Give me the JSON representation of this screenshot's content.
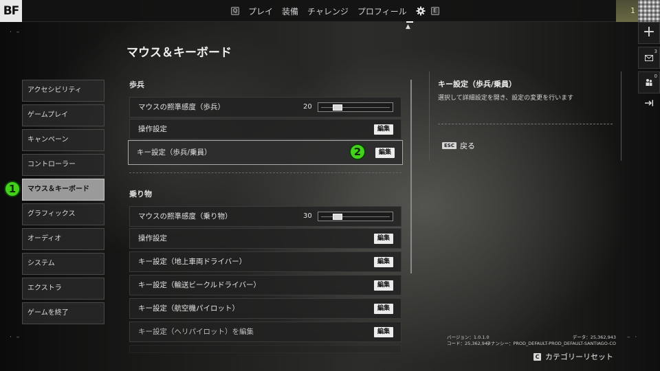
{
  "topbar": {
    "logo": "BF",
    "left_key": "Q",
    "nav": [
      "プレイ",
      "装備",
      "チャレンジ",
      "プロフィール"
    ],
    "right_key": "E",
    "level": "1"
  },
  "rail": {
    "plus": "+",
    "mail_count": "3",
    "squad_count": "0"
  },
  "page_title": "マウス＆キーボード",
  "sidebar": {
    "items": [
      {
        "label": "アクセシビリティ"
      },
      {
        "label": "ゲームプレイ"
      },
      {
        "label": "キャンペーン"
      },
      {
        "label": "コントローラー"
      },
      {
        "label": "マウス＆キーボード"
      },
      {
        "label": "グラフィックス"
      },
      {
        "label": "オーディオ"
      },
      {
        "label": "システム"
      },
      {
        "label": "エクストラ"
      },
      {
        "label": "ゲームを終了"
      }
    ],
    "active_index": 4
  },
  "annotations": {
    "badge1": "1",
    "badge2": "2"
  },
  "sections": {
    "infantry": {
      "label": "歩兵",
      "rows": {
        "sensitivity": {
          "label": "マウスの照準感度（歩兵）",
          "value": "20",
          "level": 0.2
        },
        "controls": {
          "label": "操作設定",
          "button": "編集"
        },
        "keybind": {
          "label": "キー設定（歩兵/乗員）",
          "button": "編集"
        }
      }
    },
    "vehicles": {
      "label": "乗り物",
      "rows": {
        "sensitivity": {
          "label": "マウスの照準感度（乗り物）",
          "value": "30",
          "level": 0.2
        },
        "controls": {
          "label": "操作設定",
          "button": "編集"
        },
        "ground": {
          "label": "キー設定（地上車両ドライバー）",
          "button": "編集"
        },
        "transport": {
          "label": "キー設定（輸送ビークルドライバー）",
          "button": "編集"
        },
        "aircraft": {
          "label": "キー設定（航空機パイロット）",
          "button": "編集"
        },
        "heli": {
          "label": "キー設定（ヘリパイロット）を編集",
          "button": "編集"
        }
      }
    }
  },
  "info_panel": {
    "title": "キー設定（歩兵/乗員）",
    "description": "選択して詳細設定を開き、設定の変更を行います",
    "back_key": "ESC",
    "back_label": "戻る"
  },
  "footer": {
    "version": "バージョン：1.0.1.0",
    "code": "コード：25,362,943",
    "data": "データ：25,362,943",
    "tenancy": "テナンシー：PROD_DEFAULT-PROD_DEFAULT-SANTIAGO-CO",
    "reset_key": "C",
    "reset_label": "カテゴリーリセット"
  },
  "colors": {
    "badge_green": "#44d11c",
    "active_item": "#9a9a9a"
  }
}
